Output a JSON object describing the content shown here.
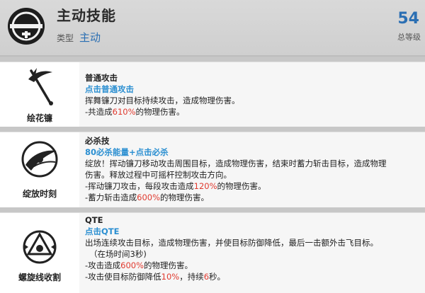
{
  "header": {
    "title": "主动技能",
    "type_label": "类型",
    "type_value": "主动",
    "level": "54",
    "level_label": "总等级"
  },
  "skills": [
    {
      "icon": "scythe-icon",
      "name": "绘花镰",
      "title": "普通攻击",
      "command": "点击普通攻击",
      "lines": [
        {
          "a": "挥舞镰刀对目标持续攻击，造成物理伤害。"
        },
        {
          "a": "-共造成",
          "r": "610%",
          "b": "的物理伤害。"
        }
      ]
    },
    {
      "icon": "bloom-slash-icon",
      "name": "绽放时刻",
      "title": "必杀技",
      "command": "80必杀能量+点击必杀",
      "lines": [
        {
          "a": "绽放！挥动镰刀移动攻击周围目标，造成物理伤害，结束时蓄力斩击目标，造成物理"
        },
        {
          "a": "伤害。释放过程中可摇杆控制攻击方向。"
        },
        {
          "a": "-挥动镰刀攻击，每段攻击造成",
          "r": "120%",
          "b": "的物理伤害。"
        },
        {
          "a": "-蓄力斩击造成",
          "r": "600%",
          "b": "的物理伤害。"
        }
      ]
    },
    {
      "icon": "spiral-reap-icon",
      "name": "螺旋线收割",
      "title": "QTE",
      "command": "点击QTE",
      "lines": [
        {
          "a": "出场连续攻击目标，造成物理伤害，并使目标防御降低，最后一击额外击飞目标。"
        },
        {
          "a": "（在场时间3秒)"
        },
        {
          "a": "-攻击造成",
          "r": "600%",
          "b": "的物理伤害。"
        },
        {
          "a": "-攻击使目标防御降低",
          "r": "10%",
          "b": "，持续",
          "r2": "6",
          "c": "秒。"
        }
      ]
    }
  ]
}
